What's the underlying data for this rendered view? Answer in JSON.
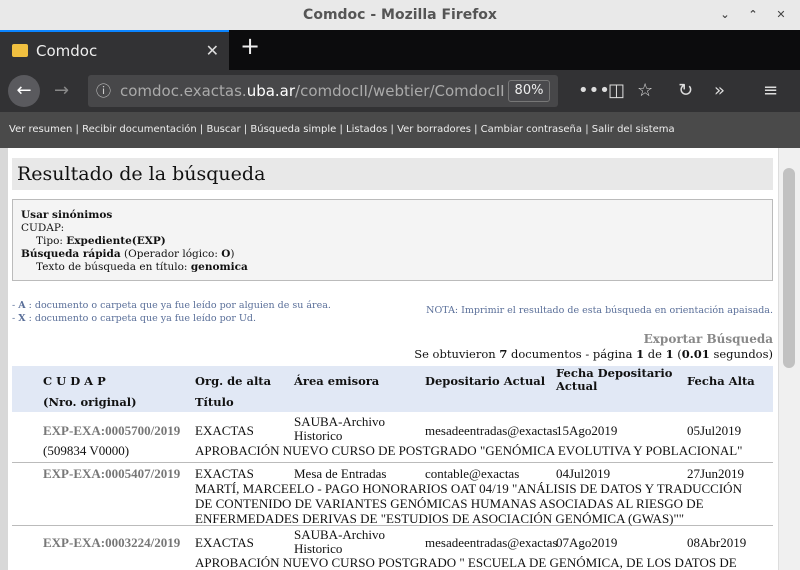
{
  "window": {
    "title": "Comdoc - Mozilla Firefox"
  },
  "tab": {
    "label": "Comdoc"
  },
  "url": {
    "prefix": "comdoc.exactas.",
    "domain": "uba.ar",
    "path": "/comdocII/webtier/ComdocII",
    "zoom": "80%"
  },
  "nav": [
    "Ver resumen",
    "Recibir documentación",
    "Buscar",
    "Búsqueda simple",
    "Listados",
    "Ver borradores",
    "Cambiar contraseña",
    "Salir del sistema"
  ],
  "page_title": "Resultado de la búsqueda",
  "search": {
    "synonyms": "Usar sinónimos",
    "cudap": "CUDAP:",
    "tipo_label": "Tipo:",
    "tipo_value": "Expediente(EXP)",
    "quick": "Búsqueda rápida",
    "operator_label": "(Operador lógico:",
    "operator_value": "O",
    "text_label": "Texto de búsqueda en título:",
    "text_value": "genomica"
  },
  "legend": {
    "a_key": "A",
    "a_text": ": documento o carpeta que ya fue leído por alguien de su área.",
    "x_key": "X",
    "x_text": ": documento o carpeta que ya fue leído por Ud."
  },
  "nota": "NOTA: Imprimir el resultado de esta búsqueda en orientación apaisada.",
  "export": "Exportar Búsqueda",
  "count": {
    "pre": "Se obtuvieron",
    "n": "7",
    "mid": "documentos - página",
    "page": "1",
    "de": "de",
    "total": "1",
    "secs": "0.01",
    "post": "segundos)"
  },
  "headers": {
    "cudap": "C U D A P",
    "orig": "(Nro. original)",
    "org": "Org. de alta",
    "titulo": "Título",
    "area": "Área emisora",
    "dep": "Depositario Actual",
    "fdep": "Fecha Depositario Actual",
    "falta": "Fecha Alta"
  },
  "rows": [
    {
      "id": "EXP-EXA:0005700/2019",
      "orig": "(509834 V0000)",
      "org": "EXACTAS",
      "area": "SAUBA-Archivo Historico",
      "dep": "mesadeentradas@exactas",
      "fdep": "15Ago2019",
      "falta": "05Jul2019",
      "title": "APROBACIÓN NUEVO CURSO DE POSTGRADO \"GENÓMICA EVOLUTIVA Y POBLACIONAL\""
    },
    {
      "id": "EXP-EXA:0005407/2019",
      "orig": "",
      "org": "EXACTAS",
      "area": "Mesa de Entradas",
      "dep": "contable@exactas",
      "fdep": "04Jul2019",
      "falta": "27Jun2019",
      "title": "MARTÍ, MARCEELO - PAGO HONORARIOS OAT 04/19 \"ANÁLISIS DE DATOS Y TRADUCCIÓN DE CONTENIDO DE VARIANTES GENÓMICAS HUMANAS ASOCIADAS AL RIESGO DE ENFERMEDADES DERIVAS DE \"ESTUDIOS DE ASOCIACIÓN GENÓMICA (GWAS)\"\""
    },
    {
      "id": "EXP-EXA:0003224/2019",
      "orig": "",
      "org": "EXACTAS",
      "area": "SAUBA-Archivo Historico",
      "dep": "mesadeentradas@exactas",
      "fdep": "07Ago2019",
      "falta": "08Abr2019",
      "title": "APROBACIÓN NUEVO CURSO POSTGRADO \" ESCUELA DE GENÓMICA, DE LOS DATOS DE NGS AL"
    }
  ]
}
